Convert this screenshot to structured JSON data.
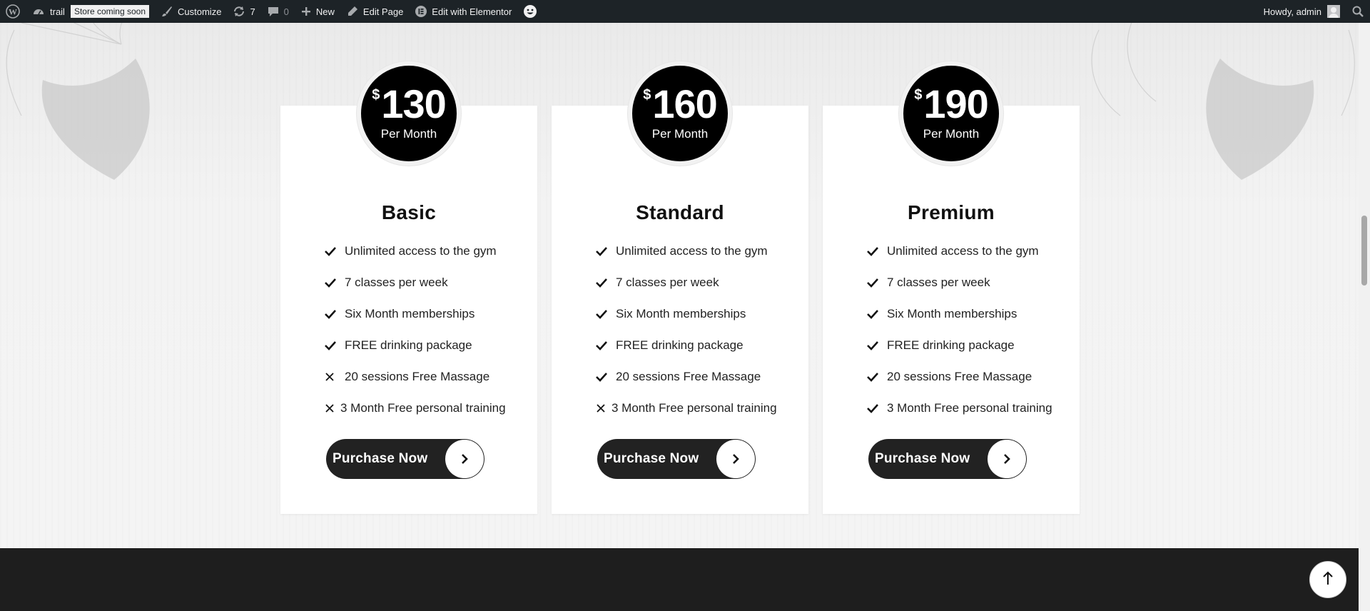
{
  "admin_bar": {
    "site_name": "trail",
    "store_badge": "Store coming soon",
    "customize": "Customize",
    "updates_count": "7",
    "comments_count": "0",
    "new": "New",
    "edit_page": "Edit Page",
    "edit_elementor": "Edit with Elementor",
    "greeting": "Howdy, admin"
  },
  "plans": [
    {
      "currency": "$",
      "price": "130",
      "period": "Per Month",
      "name": "Basic",
      "features": [
        {
          "text": "Unlimited access to the gym",
          "icon": "check-icon"
        },
        {
          "text": "7 classes per week",
          "icon": "check-icon"
        },
        {
          "text": "Six Month memberships",
          "icon": "check-icon"
        },
        {
          "text": "FREE drinking package",
          "icon": "check-icon"
        },
        {
          "text": "20 sessions Free Massage",
          "icon": "cross-icon"
        },
        {
          "text": "3 Month Free personal training",
          "icon": "cross-icon"
        }
      ],
      "button": "Purchase Now"
    },
    {
      "currency": "$",
      "price": "160",
      "period": "Per Month",
      "name": "Standard",
      "features": [
        {
          "text": "Unlimited access to the gym",
          "icon": "check-icon"
        },
        {
          "text": "7 classes per week",
          "icon": "check-icon"
        },
        {
          "text": "Six Month memberships",
          "icon": "check-icon"
        },
        {
          "text": "FREE drinking package",
          "icon": "check-icon"
        },
        {
          "text": "20 sessions Free Massage",
          "icon": "check-icon"
        },
        {
          "text": "3 Month Free personal training",
          "icon": "cross-icon"
        }
      ],
      "button": "Purchase Now"
    },
    {
      "currency": "$",
      "price": "190",
      "period": "Per Month",
      "name": "Premium",
      "features": [
        {
          "text": "Unlimited access to the gym",
          "icon": "check-icon"
        },
        {
          "text": "7 classes per week",
          "icon": "check-icon"
        },
        {
          "text": "Six Month memberships",
          "icon": "check-icon"
        },
        {
          "text": "FREE drinking package",
          "icon": "check-icon"
        },
        {
          "text": "20 sessions Free Massage",
          "icon": "check-icon"
        },
        {
          "text": "3 Month Free personal training",
          "icon": "check-icon"
        }
      ],
      "button": "Purchase Now"
    }
  ]
}
